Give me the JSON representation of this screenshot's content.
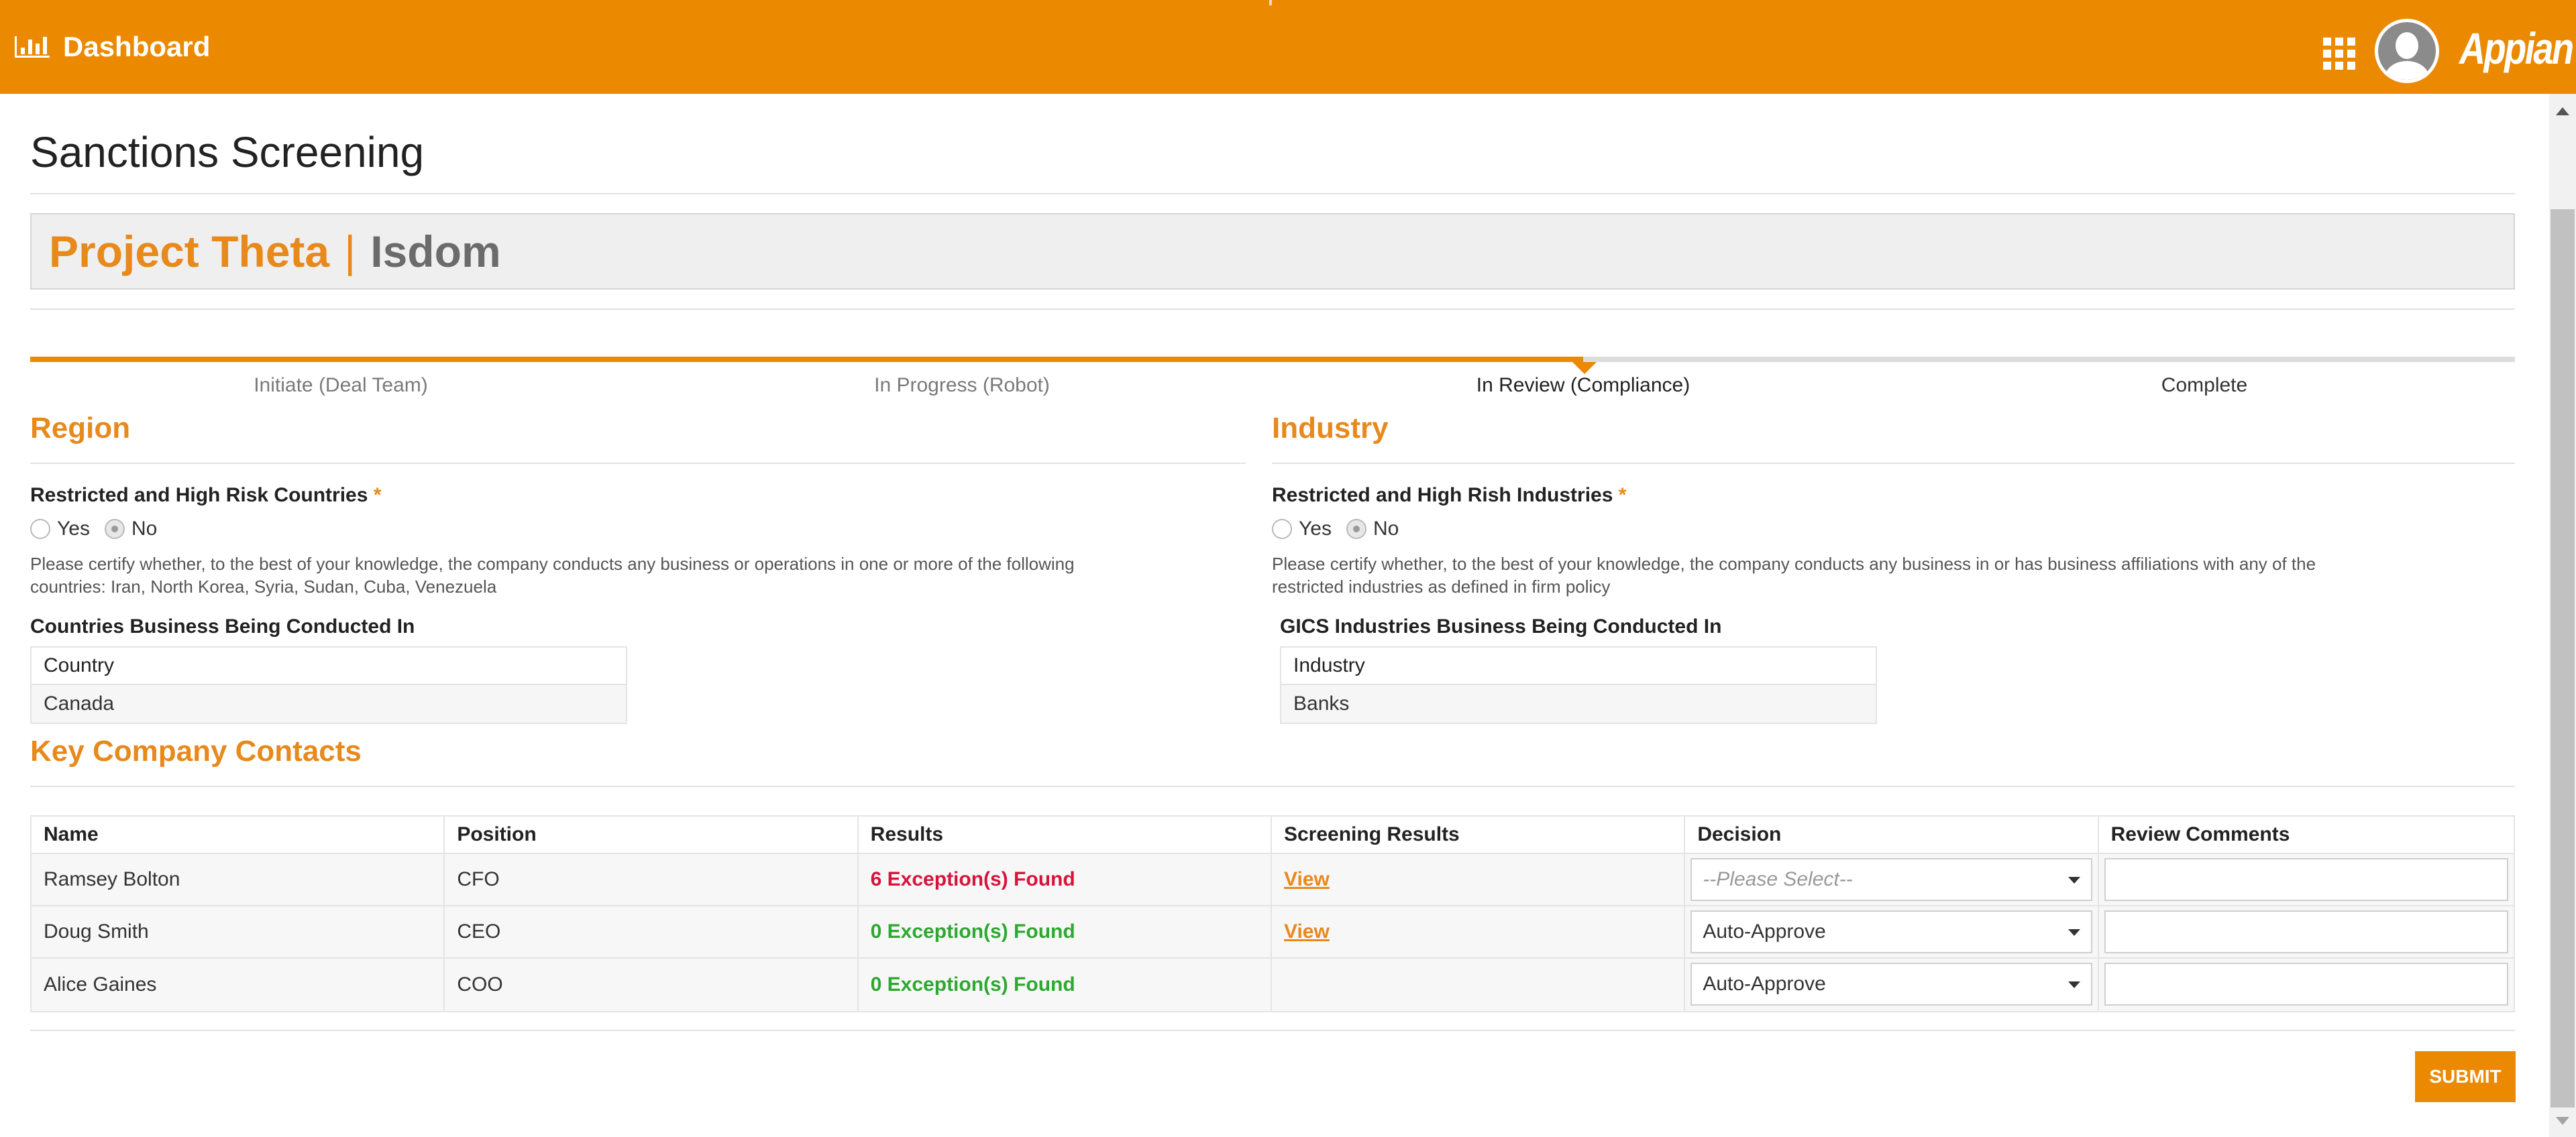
{
  "header": {
    "nav_label": "Dashboard",
    "nav_icon": "bar-chart-icon",
    "apps_icon": "grid-icon",
    "logo_text": "Appian",
    "brand_color": "#eb8a00"
  },
  "page": {
    "title": "Sanctions Screening",
    "project_name": "Project Theta",
    "separator": "|",
    "company_name": "Isdom"
  },
  "progress": {
    "fraction_complete": 0.625,
    "steps": [
      {
        "label": "Initiate (Deal Team)",
        "state": "done"
      },
      {
        "label": "In Progress (Robot)",
        "state": "done"
      },
      {
        "label": "In Review (Compliance)",
        "state": "current"
      },
      {
        "label": "Complete",
        "state": "upcoming"
      }
    ]
  },
  "region": {
    "title": "Region",
    "question": "Restricted and High Risk Countries",
    "required_mark": "*",
    "options": [
      "Yes",
      "No"
    ],
    "selected": "No",
    "help_text": "Please certify whether, to the best of your knowledge, the company conducts any business or operations in one or more of the following countries: Iran, North Korea, Syria, Sudan, Cuba, Venezuela",
    "table_title": "Countries Business Being Conducted In",
    "table_header": "Country",
    "table_rows": [
      "Canada"
    ]
  },
  "industry": {
    "title": "Industry",
    "question": "Restricted and High Rish Industries",
    "required_mark": "*",
    "options": [
      "Yes",
      "No"
    ],
    "selected": "No",
    "help_text": "Please certify whether, to the best of your knowledge, the company conducts any business in or has business affiliations with any of the restricted industries as defined in firm policy",
    "table_title": "GICS Industries Business Being Conducted In",
    "table_header": "Industry",
    "table_rows": [
      "Banks"
    ]
  },
  "contacts": {
    "title": "Key Company Contacts",
    "columns": [
      "Name",
      "Position",
      "Results",
      "Screening Results",
      "Decision",
      "Review Comments"
    ],
    "rows": [
      {
        "name": "Ramsey Bolton",
        "position": "CFO",
        "results": "6 Exception(s) Found",
        "result_status": "exceptions",
        "screening": "View",
        "decision": "--Please Select--",
        "decision_placeholder": true,
        "comment": ""
      },
      {
        "name": "Doug Smith",
        "position": "CEO",
        "results": "0 Exception(s) Found",
        "result_status": "clear",
        "screening": "View",
        "decision": "Auto-Approve",
        "decision_placeholder": false,
        "comment": ""
      },
      {
        "name": "Alice Gaines",
        "position": "COO",
        "results": "0 Exception(s) Found",
        "result_status": "clear",
        "screening": "",
        "decision": "Auto-Approve",
        "decision_placeholder": false,
        "comment": ""
      }
    ]
  },
  "actions": {
    "submit_label": "SUBMIT"
  }
}
